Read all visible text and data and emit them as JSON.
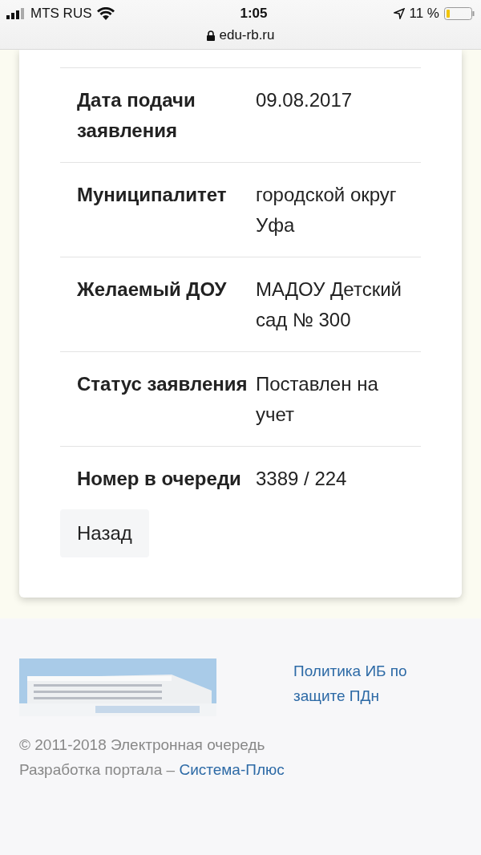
{
  "status_bar": {
    "carrier": "MTS RUS",
    "time": "1:05",
    "battery": "11 %",
    "url": "edu-rb.ru"
  },
  "details": [
    {
      "label": "Дата подачи заявления",
      "value": "09.08.2017"
    },
    {
      "label": "Муниципалитет",
      "value": "городской округ Уфа"
    },
    {
      "label": "Желаемый ДОУ",
      "value": "МАДОУ Детский сад № 300"
    },
    {
      "label": "Статус заявления",
      "value": "Поставлен на учет"
    },
    {
      "label": "Номер в очереди",
      "value": "3389 / 224"
    }
  ],
  "back_button": "Назад",
  "footer": {
    "policy_link": "Политика ИБ по защите ПДн",
    "copyright": "© 2011-2018 Электронная очередь",
    "developer_prefix": "Разработка портала –",
    "developer_link": "Система-Плюс"
  }
}
